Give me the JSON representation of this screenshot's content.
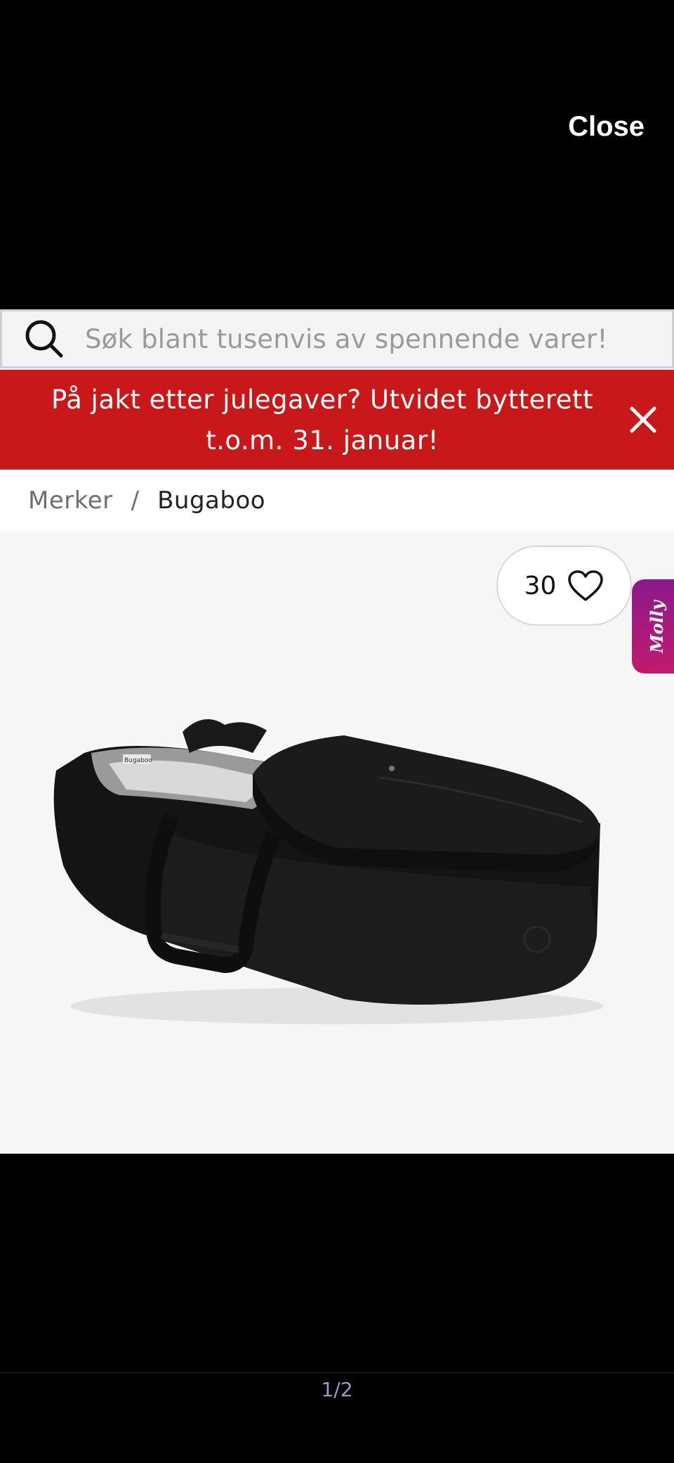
{
  "viewer": {
    "close_label": "Close",
    "pager": "1/2"
  },
  "search": {
    "placeholder": "Søk blant tusenvis av spennende varer!",
    "icon": "search-icon"
  },
  "promo": {
    "line1": "På jakt etter julegaver? Utvidet bytterett",
    "line2": "t.o.m. 31. januar!",
    "background": "#c8181a"
  },
  "breadcrumb": {
    "items": [
      "Merker",
      "Bugaboo"
    ],
    "separator": "/"
  },
  "product": {
    "favorite_count": "30",
    "image": "black bassinet carrycot",
    "brand_mark": "Bugaboo"
  },
  "molly": {
    "label": "Molly",
    "accent": "#a81a7e"
  }
}
